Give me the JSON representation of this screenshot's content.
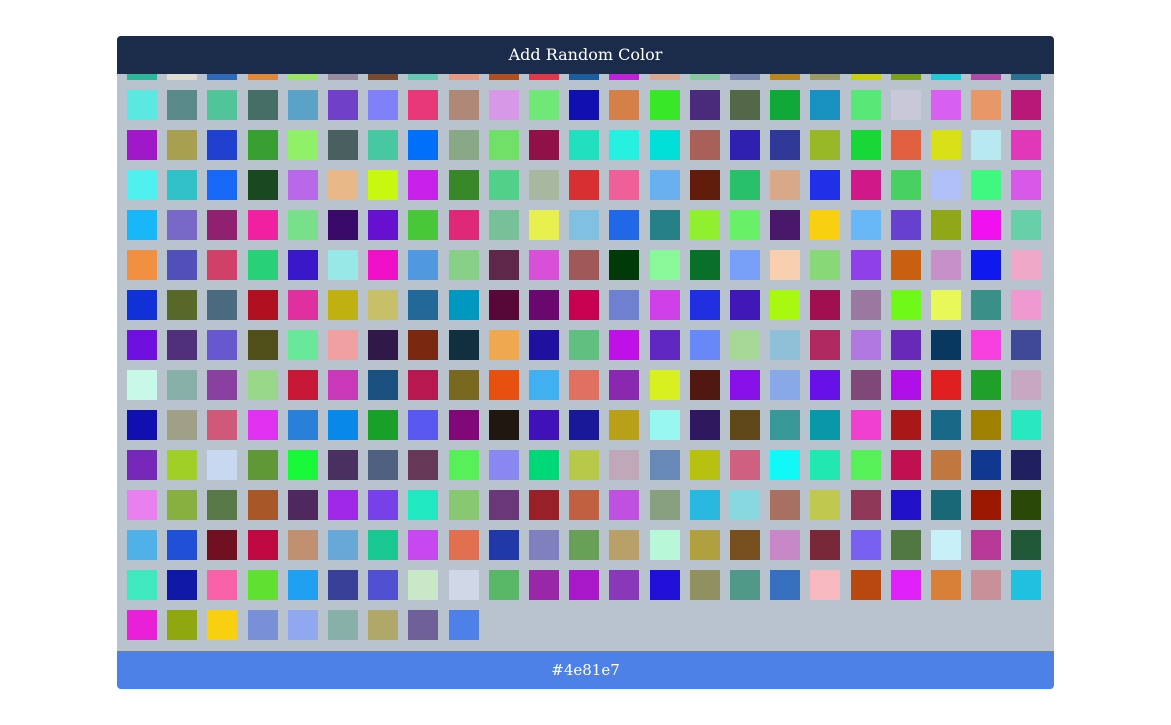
{
  "add_button_label": "Add Random Color",
  "selected_color": "#4e81e7",
  "selected_index": 331,
  "columns": 23,
  "swatch_colors": [
    "#2bb89a",
    "#e0dcd2",
    "#2e6ab8",
    "#e08838",
    "#9ce468",
    "#9a8aa0",
    "#7a4a30",
    "#66c8b0",
    "#e89880",
    "#b05020",
    "#e03848",
    "#1a5ea0",
    "#c020d8",
    "#d8a890",
    "#88c8a0",
    "#7a88b0",
    "#b8861c",
    "#9a9a66",
    "#c8d010",
    "#7aa218",
    "#20c8d8",
    "#b048a8",
    "#2a7090",
    "#5ae8e0",
    "#5a8a88",
    "#52c49a",
    "#466e64",
    "#5aa2c8",
    "#7040c8",
    "#8080f8",
    "#e83878",
    "#b08878",
    "#d898e8",
    "#70e878",
    "#1010b0",
    "#d48048",
    "#38e828",
    "#4a2a7a",
    "#526848",
    "#10a838",
    "#1890c0",
    "#58e878",
    "#c8c8d8",
    "#d860f0",
    "#e89868",
    "#b81878",
    "#a018c8",
    "#a8a050",
    "#2040d0",
    "#38a030",
    "#90f068",
    "#4a6060",
    "#48c8a0",
    "#0070f8",
    "#88a888",
    "#70e068",
    "#901048",
    "#20e0c0",
    "#28f0e0",
    "#00e0d8",
    "#a86058",
    "#3020b0",
    "#303898",
    "#98b828",
    "#18d838",
    "#e06040",
    "#d8e018",
    "#b8e8f0",
    "#e038b8",
    "#50f0f0",
    "#30c0c8",
    "#1868f8",
    "#1a4820",
    "#b868e8",
    "#e8b888",
    "#c8f810",
    "#c820e8",
    "#38882a",
    "#50d088",
    "#a8b8a0",
    "#d83030",
    "#f06098",
    "#68b0f0",
    "#621c0c",
    "#28c068",
    "#d8a888",
    "#2030e8",
    "#d01888",
    "#48d060",
    "#b0c0f8",
    "#40f880",
    "#d858e8",
    "#18b8f8",
    "#7868c8",
    "#902070",
    "#f020a0",
    "#78e088",
    "#3a0a6a",
    "#6810d0",
    "#48c838",
    "#e02878",
    "#78c098",
    "#e8f050",
    "#80c0e0",
    "#2068e8",
    "#258088",
    "#90f030",
    "#68f068",
    "#4a186a",
    "#f8d010",
    "#68b8f8",
    "#6840d0",
    "#90a818",
    "#f010f0",
    "#68d0a8",
    "#f09040",
    "#5050b8",
    "#d04068",
    "#28d078",
    "#3818c8",
    "#98e8e8",
    "#f010c8",
    "#5098e0",
    "#88d088",
    "#602848",
    "#d850d8",
    "#a05858",
    "#003a08",
    "#88f898",
    "#087028",
    "#78a0f8",
    "#f8d0b0",
    "#88d878",
    "#9040e8",
    "#c86010",
    "#c890c8",
    "#1018f0",
    "#f0a8c8",
    "#1030d8",
    "#586828",
    "#4a6a80",
    "#b01020",
    "#e030a0",
    "#c0b010",
    "#c8c068",
    "#226898",
    "#0098c0",
    "#580838",
    "#6a0870",
    "#c80050",
    "#7080d0",
    "#d040e8",
    "#2030e0",
    "#4018b8",
    "#a8f810",
    "#a01050",
    "#9a78a0",
    "#70f818",
    "#e8f858",
    "#389088",
    "#f098d0",
    "#7010e0",
    "#50307a",
    "#6858d0",
    "#505018",
    "#68e898",
    "#f0a0a0",
    "#301848",
    "#7a2810",
    "#103040",
    "#f0a850",
    "#2010a0",
    "#60c080",
    "#c010e8",
    "#6028c0",
    "#6888f8",
    "#a8d898",
    "#90c0d8",
    "#b02860",
    "#b078e0",
    "#6828b8",
    "#083860",
    "#f840e0",
    "#404898",
    "#c8f8e8",
    "#88b0a8",
    "#8a40a0",
    "#98d888",
    "#c81838",
    "#c838b8",
    "#1a5080",
    "#b81850",
    "#786820",
    "#e85010",
    "#40b0f0",
    "#e07060",
    "#8a28b0",
    "#d8f020",
    "#501810",
    "#8810e8",
    "#88a8e8",
    "#6810e8",
    "#804878",
    "#b010e8",
    "#e02020",
    "#20a028",
    "#c8a8c0",
    "#1010b0",
    "#a0a088",
    "#d05878",
    "#e030f0",
    "#2880d8",
    "#0888e8",
    "#18a028",
    "#5858f0",
    "#800878",
    "#201810",
    "#4010b8",
    "#181898",
    "#b8a018",
    "#98f8f0",
    "#301860",
    "#604818",
    "#389898",
    "#0898a8",
    "#f040d0",
    "#a81818",
    "#186888",
    "#a08000",
    "#28e8c0",
    "#7828b8",
    "#a0d028",
    "#c8d8f0",
    "#609838",
    "#18f838",
    "#4a3060",
    "#506080",
    "#683858",
    "#58f058",
    "#8888f0",
    "#00d878",
    "#b8c848",
    "#c0a8b8",
    "#6888b8",
    "#b8c010",
    "#d06080",
    "#10f8f8",
    "#20e8b0",
    "#58f058",
    "#c01050",
    "#c07840",
    "#103890",
    "#202060",
    "#e880f0",
    "#88b040",
    "#587848",
    "#a85828",
    "#502860",
    "#a028e8",
    "#7840e8",
    "#20e8c0",
    "#88c870",
    "#6a3878",
    "#982028",
    "#c06040",
    "#c050e0",
    "#88a080",
    "#28b8e0",
    "#88d8e0",
    "#a87060",
    "#c0c850",
    "#903858",
    "#2010c8",
    "#186878",
    "#9a1800",
    "#2a4808",
    "#50b0e8",
    "#2050d8",
    "#701020",
    "#c00840",
    "#c09070",
    "#68a8d8",
    "#18c890",
    "#c848f0",
    "#e07050",
    "#2038a8",
    "#8080c0",
    "#68a058",
    "#b8a068",
    "#b8f8d8",
    "#b0a040",
    "#785020",
    "#c888c8",
    "#782838",
    "#7860f0",
    "#507840",
    "#c8f0f8",
    "#b83898",
    "#205838",
    "#40e8c0",
    "#1018a8",
    "#f860a8",
    "#60e030",
    "#20a0f0",
    "#384098",
    "#5050d0",
    "#c8e8c8",
    "#d0d8e8",
    "#58b868",
    "#9828a8",
    "#a818c8",
    "#8838b8",
    "#2010d8",
    "#909060",
    "#509888",
    "#3870c0",
    "#f8b8c0",
    "#b84810",
    "#e020f8",
    "#d88038",
    "#c89098",
    "#20c0e0",
    "#e820d8",
    "#90a810",
    "#f8d010",
    "#7890d8",
    "#90a8f0",
    "#88b0a8",
    "#b0a868",
    "#70609a",
    "#4e81e7"
  ]
}
